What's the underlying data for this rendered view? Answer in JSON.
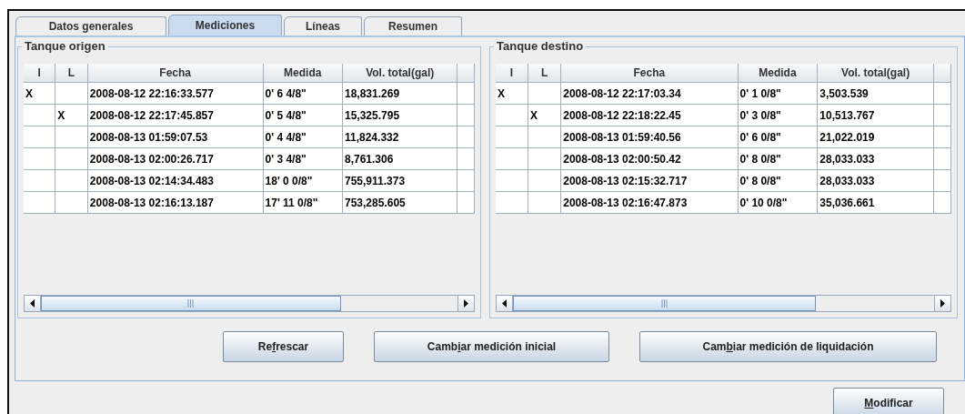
{
  "tabs": [
    {
      "label": "Datos generales",
      "selected": false
    },
    {
      "label": "Mediciones",
      "selected": true
    },
    {
      "label": "Líneas",
      "selected": false
    },
    {
      "label": "Resumen",
      "selected": false
    }
  ],
  "panels": [
    {
      "title": "Tanque origen",
      "columns": [
        "I",
        "L",
        "Fecha",
        "Medida",
        "Vol. total(gal)"
      ],
      "rows": [
        {
          "i": "X",
          "fecha": "2008-08-12 22:16:33.577",
          "medida": "0' 6 4/8\"",
          "vol": "18,831.269"
        },
        {
          "l": "X",
          "fecha": "2008-08-12 22:17:45.857",
          "medida": "0' 5 4/8\"",
          "vol": "15,325.795"
        },
        {
          "fecha": "2008-08-13 01:59:07.53",
          "medida": "0' 4 4/8\"",
          "vol": "11,824.332"
        },
        {
          "fecha": "2008-08-13 02:00:26.717",
          "medida": "0' 3 4/8\"",
          "vol": "8,761.306"
        },
        {
          "fecha": "2008-08-13 02:14:34.483",
          "medida": "18' 0 0/8\"",
          "vol": "755,911.373"
        },
        {
          "fecha": "2008-08-13 02:16:13.187",
          "medida": "17' 11 0/8\"",
          "vol": "753,285.605"
        }
      ]
    },
    {
      "title": "Tanque destino",
      "columns": [
        "I",
        "L",
        "Fecha",
        "Medida",
        "Vol. total(gal)"
      ],
      "rows": [
        {
          "i": "X",
          "fecha": "2008-08-12 22:17:03.34",
          "medida": "0' 1 0/8\"",
          "vol": "3,503.539"
        },
        {
          "l": "X",
          "fecha": "2008-08-12 22:18:22.45",
          "medida": "0' 3 0/8\"",
          "vol": "10,513.767"
        },
        {
          "fecha": "2008-08-13 01:59:40.56",
          "medida": "0' 6 0/8\"",
          "vol": "21,022.019"
        },
        {
          "fecha": "2008-08-13 02:00:50.42",
          "medida": "0' 8 0/8\"",
          "vol": "28,033.033"
        },
        {
          "fecha": "2008-08-13 02:15:32.717",
          "medida": "0' 8 0/8\"",
          "vol": "28,033.033"
        },
        {
          "fecha": "2008-08-13 02:16:47.873",
          "medida": "0' 10 0/8\"",
          "vol": "35,036.661"
        }
      ]
    }
  ],
  "actions": [
    {
      "before": "Re",
      "mnemonic": "f",
      "after": "rescar"
    },
    {
      "before": "Camb",
      "mnemonic": "i",
      "after": "ar medición inicial"
    },
    {
      "before": "Cam",
      "mnemonic": "b",
      "after": "iar medición de liquidación"
    }
  ],
  "footer_button": {
    "mnemonic": "M",
    "after": "odificar"
  }
}
